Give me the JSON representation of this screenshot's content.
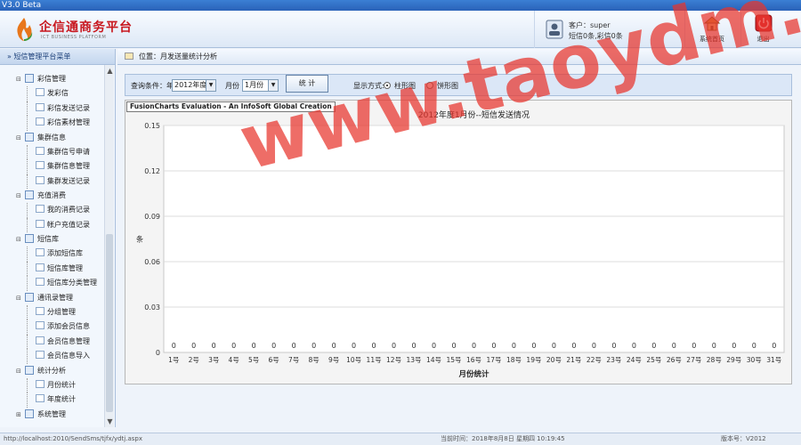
{
  "window": {
    "title": "V3.0  Beta"
  },
  "header": {
    "brand": "企信通商务平台",
    "brand_sub": "ICT BUSINESS PLATFORM",
    "user_line1": "客户：super",
    "user_line2": "短信0条,彩信0条",
    "home_label": "系统首页",
    "exit_label": "退出"
  },
  "sidebar": {
    "title": "» 短信管理平台菜单",
    "groups": [
      {
        "label": "彩信管理",
        "items": [
          "发彩信",
          "彩信发送记录",
          "彩信素材管理"
        ]
      },
      {
        "label": "集群信息",
        "items": [
          "集群信号申请",
          "集群信息管理",
          "集群发送记录"
        ]
      },
      {
        "label": "充值消费",
        "items": [
          "我的消费记录",
          "帐户充值记录"
        ]
      },
      {
        "label": "短信库",
        "items": [
          "添加短信库",
          "短信库管理",
          "短信库分类管理"
        ]
      },
      {
        "label": "通讯录管理",
        "items": [
          "分组管理",
          "添加会员信息",
          "会员信息管理",
          "会员信息导入"
        ]
      },
      {
        "label": "统计分析",
        "items": [
          "月份统计",
          "年度统计"
        ]
      },
      {
        "label": "系统管理",
        "items": []
      }
    ]
  },
  "breadcrumb": {
    "text": "位置：月发送量统计分析"
  },
  "filter": {
    "query_label": "查询条件：年份",
    "year_value": "2012年度",
    "month_label": "月份",
    "month_value": "1月份",
    "stat_button": "统 计",
    "display_label": "显示方式:",
    "opt_bar": "柱形图",
    "opt_pie": "饼形图"
  },
  "chart_data": {
    "type": "bar",
    "eval_banner": "FusionCharts Evaluation - An InfoSoft Global Creation",
    "title": "2012年度1月份--短信发送情况",
    "xlabel": "月份统计",
    "ylabel": "条",
    "ylim": [
      0,
      0.15
    ],
    "yticks": [
      "0",
      "0.03",
      "0.06",
      "0.09",
      "0.12",
      "0.15"
    ],
    "categories": [
      "1号",
      "2号",
      "3号",
      "4号",
      "5号",
      "6号",
      "7号",
      "8号",
      "9号",
      "10号",
      "11号",
      "12号",
      "13号",
      "14号",
      "15号",
      "16号",
      "17号",
      "18号",
      "19号",
      "20号",
      "21号",
      "22号",
      "23号",
      "24号",
      "25号",
      "26号",
      "27号",
      "28号",
      "29号",
      "30号",
      "31号"
    ],
    "values": [
      0,
      0,
      0,
      0,
      0,
      0,
      0,
      0,
      0,
      0,
      0,
      0,
      0,
      0,
      0,
      0,
      0,
      0,
      0,
      0,
      0,
      0,
      0,
      0,
      0,
      0,
      0,
      0,
      0,
      0,
      0
    ],
    "grid": true
  },
  "watermark": "www.taoydm.com",
  "statusbar": {
    "url": "http://localhost:2010/SendSms/tjfx/ydtj.aspx",
    "time": "当前时间：2018年8月8日 星期四 10:19:45",
    "version": "版本号：V2012"
  },
  "colors": {
    "accent": "#2a62b8",
    "brand": "#c8171e",
    "watermark": "#e8352d"
  }
}
